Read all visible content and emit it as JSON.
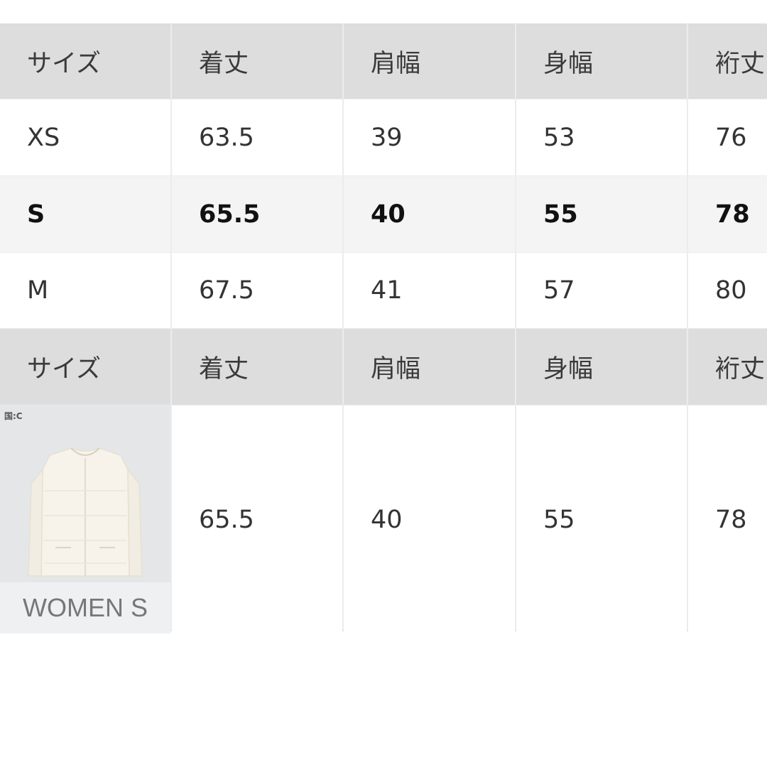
{
  "table": {
    "headers": [
      "サイズ",
      "着丈",
      "肩幅",
      "身幅",
      "裄丈"
    ],
    "rows": [
      {
        "size": "XS",
        "values": [
          "63.5",
          "39",
          "53",
          "76"
        ]
      },
      {
        "size": "S",
        "values": [
          "65.5",
          "40",
          "55",
          "78"
        ]
      },
      {
        "size": "M",
        "values": [
          "67.5",
          "41",
          "57",
          "80"
        ]
      }
    ],
    "headers2": [
      "サイズ",
      "着丈",
      "肩幅",
      "身幅",
      "裄丈"
    ],
    "product": {
      "badge": "国:C",
      "caption": "WOMEN S",
      "values": [
        "65.5",
        "40",
        "55",
        "78"
      ]
    }
  },
  "colors": {
    "header_bg": "#dddddd",
    "highlight_row_bg": "#f4f4f4",
    "product_bg": "#e4e6e8"
  },
  "icons": [
    "jacket-image"
  ]
}
